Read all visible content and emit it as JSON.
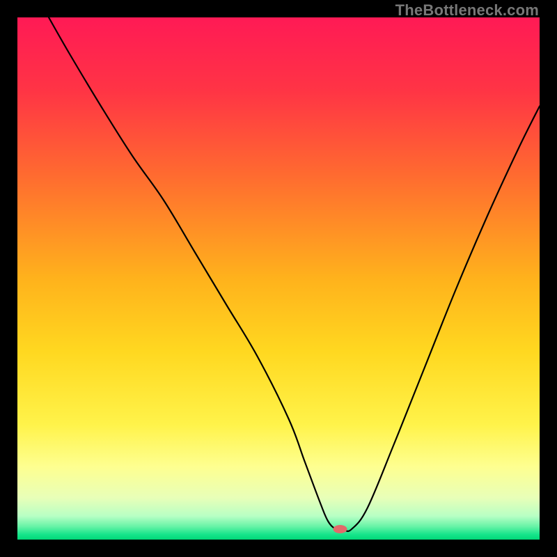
{
  "watermark": "TheBottleneck.com",
  "chart_data": {
    "type": "line",
    "title": "",
    "xlabel": "",
    "ylabel": "",
    "xlim": [
      0,
      100
    ],
    "ylim": [
      0,
      100
    ],
    "background": {
      "type": "vertical-gradient",
      "stops": [
        {
          "pos": 0.0,
          "color": "#ff1a55"
        },
        {
          "pos": 0.14,
          "color": "#ff3445"
        },
        {
          "pos": 0.3,
          "color": "#ff6a30"
        },
        {
          "pos": 0.5,
          "color": "#ffb21c"
        },
        {
          "pos": 0.64,
          "color": "#ffd820"
        },
        {
          "pos": 0.78,
          "color": "#fff34a"
        },
        {
          "pos": 0.86,
          "color": "#feff90"
        },
        {
          "pos": 0.92,
          "color": "#e8ffb8"
        },
        {
          "pos": 0.955,
          "color": "#b8ffc4"
        },
        {
          "pos": 0.975,
          "color": "#66f3a6"
        },
        {
          "pos": 0.99,
          "color": "#17e58b"
        },
        {
          "pos": 1.0,
          "color": "#00d878"
        }
      ]
    },
    "series": [
      {
        "name": "bottleneck-curve",
        "color": "#000000",
        "width": 2.2,
        "x": [
          6,
          10,
          16,
          22,
          28,
          34,
          40,
          46,
          52,
          55,
          58,
          59.5,
          61,
          62.5,
          64,
          67,
          72,
          78,
          84,
          90,
          96,
          100
        ],
        "y": [
          100,
          93,
          83,
          73.5,
          65,
          55,
          45,
          35,
          23,
          15,
          7,
          3.5,
          2,
          1.8,
          2,
          6,
          18,
          33,
          48,
          62,
          75,
          83
        ]
      }
    ],
    "marker": {
      "name": "optimal-point",
      "x": 61.8,
      "y": 2.0,
      "color": "#e26a6a",
      "rx": 10,
      "ry": 6
    },
    "grid": false,
    "legend": false
  }
}
